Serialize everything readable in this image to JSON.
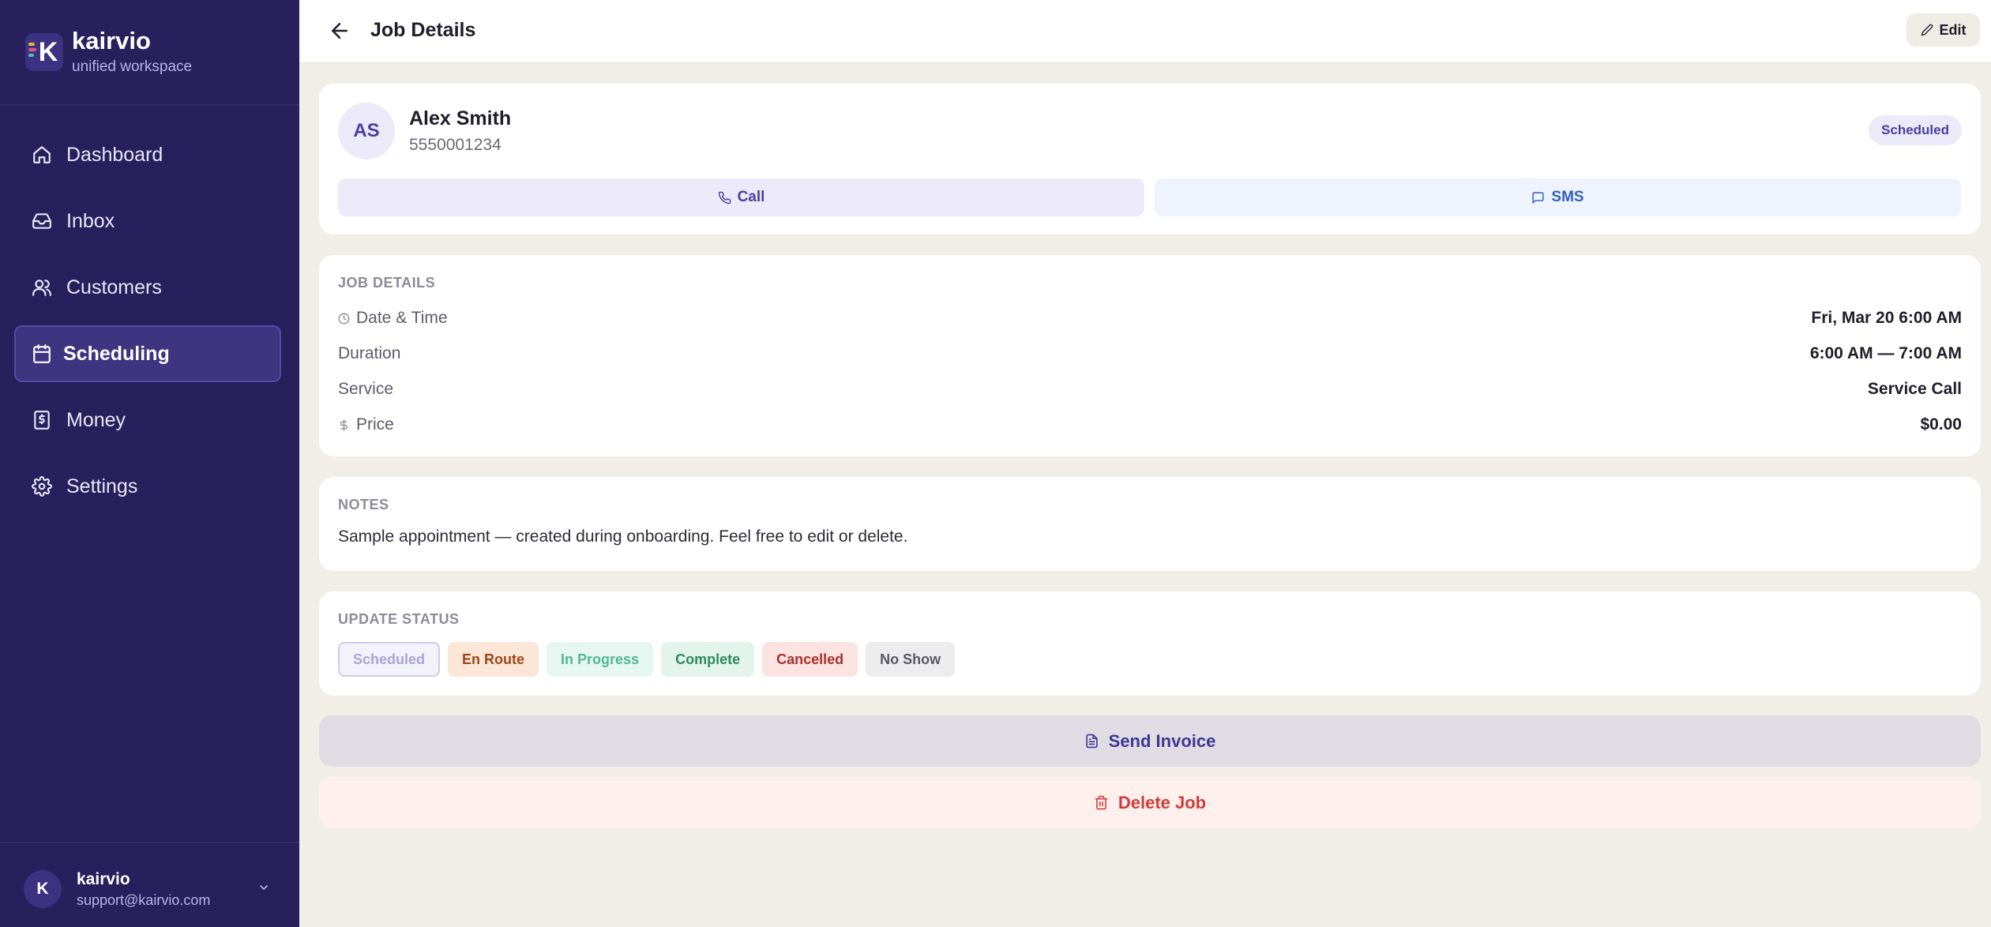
{
  "brand": {
    "name": "kairvio",
    "tagline": "unified workspace"
  },
  "sidebar": {
    "items": [
      {
        "label": "Dashboard",
        "icon": "home-icon",
        "active": false
      },
      {
        "label": "Inbox",
        "icon": "inbox-icon",
        "active": false
      },
      {
        "label": "Customers",
        "icon": "users-icon",
        "active": false
      },
      {
        "label": "Scheduling",
        "icon": "calendar-icon",
        "active": true
      },
      {
        "label": "Money",
        "icon": "receipt-icon",
        "active": false
      },
      {
        "label": "Settings",
        "icon": "gear-icon",
        "active": false
      }
    ]
  },
  "user": {
    "initial": "K",
    "name": "kairvio",
    "email": "support@kairvio.com"
  },
  "header": {
    "title": "Job Details",
    "edit_label": "Edit"
  },
  "customer": {
    "initials": "AS",
    "name": "Alex Smith",
    "phone": "5550001234",
    "status": "Scheduled",
    "call_label": "Call",
    "sms_label": "SMS"
  },
  "details": {
    "section_label": "JOB DETAILS",
    "rows": [
      {
        "label": "Date & Time",
        "value": "Fri, Mar 20 6:00 AM",
        "icon": "clock-icon"
      },
      {
        "label": "Duration",
        "value": "6:00 AM — 7:00 AM"
      },
      {
        "label": "Service",
        "value": "Service Call"
      },
      {
        "label": "Price",
        "value": "$0.00",
        "icon": "dollar-icon"
      }
    ]
  },
  "notes": {
    "section_label": "NOTES",
    "text": "Sample appointment — created during onboarding. Feel free to edit or delete."
  },
  "status_update": {
    "section_label": "UPDATE STATUS",
    "options": [
      "Scheduled",
      "En Route",
      "In Progress",
      "Complete",
      "Cancelled",
      "No Show"
    ],
    "current": "Scheduled"
  },
  "actions": {
    "send_invoice_label": "Send Invoice",
    "delete_label": "Delete Job"
  },
  "colors": {
    "sidebar_bg": "#27205c",
    "accent": "#4a3fa0",
    "page_bg": "#f1eee8",
    "danger": "#cf3c3a"
  }
}
